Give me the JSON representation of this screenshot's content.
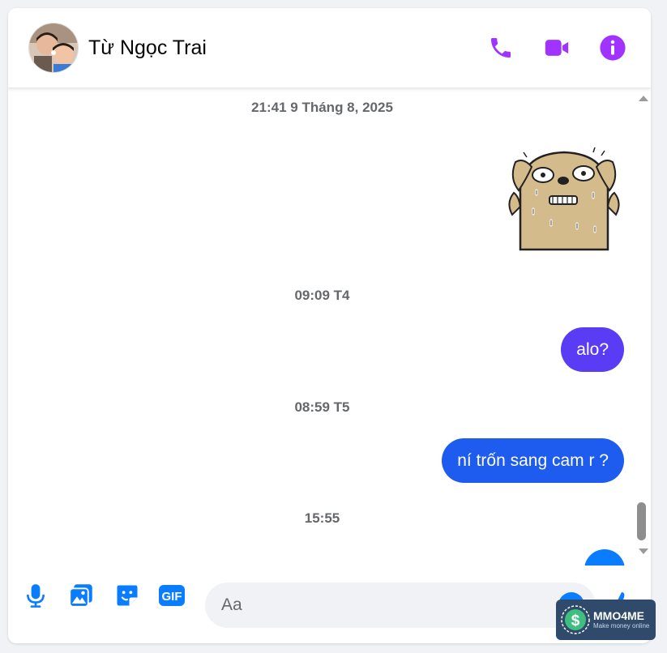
{
  "header": {
    "contact_name": "Từ Ngọc Trai",
    "actions": [
      "phone-icon",
      "video-icon",
      "info-icon"
    ]
  },
  "colors": {
    "accent": "#a033ff",
    "bubble_purple": "#5b3cf5",
    "bubble_blue": "#1e5cf0",
    "composer_icon": "#0a7cff",
    "timestamp": "#65676b"
  },
  "conversation": {
    "timestamps": [
      "21:41 9 Tháng 8, 2025",
      "09:09 T4",
      "08:59 T5",
      "15:55"
    ],
    "messages": [
      {
        "type": "sticker",
        "name": "sweating-dog-sticker"
      },
      {
        "type": "text",
        "text": "alo?"
      },
      {
        "type": "text",
        "text": "ní trốn sang cam r ?"
      }
    ]
  },
  "composer": {
    "tools": [
      "microphone-icon",
      "image-icon",
      "sticker-icon",
      "gif-icon"
    ],
    "gif_label": "GIF",
    "placeholder": "Aa"
  },
  "watermark": {
    "brand": "MMO4ME",
    "tagline": "Make money online"
  }
}
